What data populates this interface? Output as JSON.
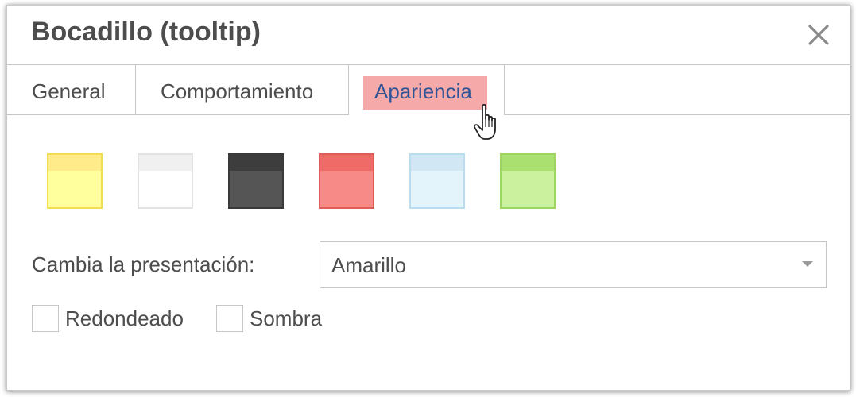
{
  "dialog": {
    "title": "Bocadillo (tooltip)",
    "close_icon": "close-icon"
  },
  "tabs": [
    {
      "label": "General",
      "active": false
    },
    {
      "label": "Comportamiento",
      "active": false
    },
    {
      "label": "Apariencia",
      "active": true
    }
  ],
  "colors": {
    "active_tab_highlight": "#f5a9a9",
    "active_tab_text": "#2f5597",
    "text": "#4d4d4d",
    "border": "#c6c6c6"
  },
  "swatches": [
    {
      "name": "yellow",
      "fill": "#ffff9e",
      "band": "#ffeb8a",
      "border": "#f2dd50"
    },
    {
      "name": "white",
      "fill": "#ffffff",
      "band": "#f0f0f0",
      "border": "#e2e2e2"
    },
    {
      "name": "dark",
      "fill": "#555555",
      "band": "#3d3d3d",
      "border": "#3a3a3a"
    },
    {
      "name": "red",
      "fill": "#f78a86",
      "band": "#ef6b67",
      "border": "#e05c58"
    },
    {
      "name": "light-blue",
      "fill": "#e3f4fb",
      "band": "#d1e8f4",
      "border": "#b9dcee"
    },
    {
      "name": "green",
      "fill": "#ccf19e",
      "band": "#a9e070",
      "border": "#9bd65f"
    }
  ],
  "presentation": {
    "label": "Cambia la presentación:",
    "selected": "Amarillo"
  },
  "options": {
    "rounded_label": "Redondeado",
    "rounded_checked": false,
    "shadow_label": "Sombra",
    "shadow_checked": false
  }
}
